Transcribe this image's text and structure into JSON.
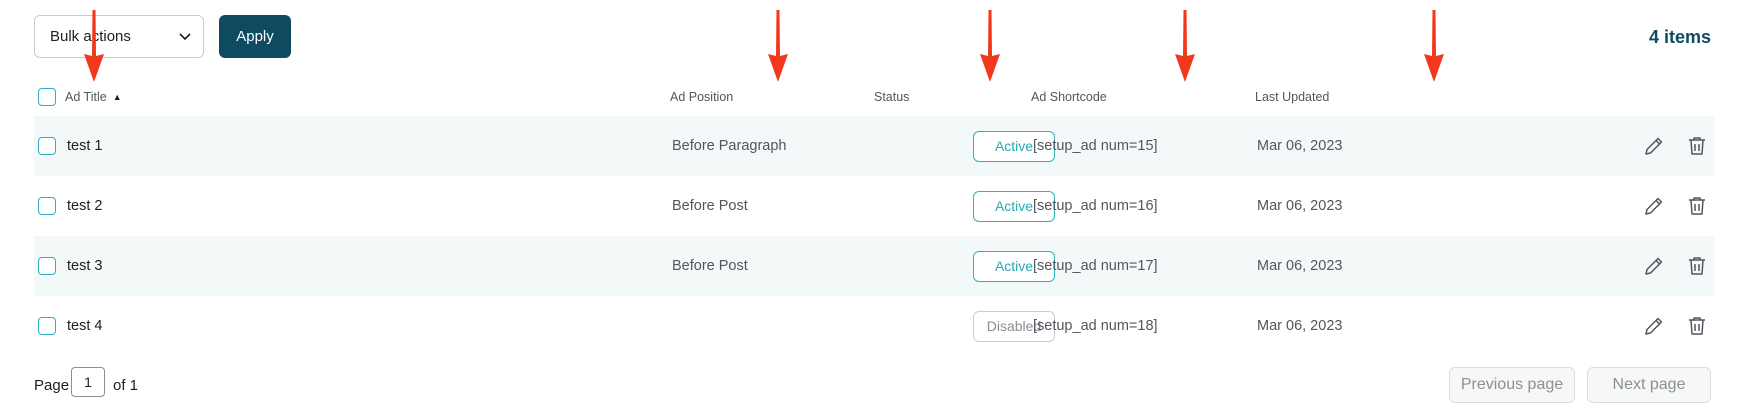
{
  "toolbar": {
    "bulk_label": "Bulk actions",
    "apply_label": "Apply",
    "item_count": "4 items"
  },
  "table": {
    "columns": [
      "Ad Title",
      "Ad Position",
      "Status",
      "Ad Shortcode",
      "Last Updated"
    ],
    "sort_indicator": "▲",
    "rows": [
      {
        "title": "test 1",
        "position": "Before Paragraph",
        "status": "Active",
        "shortcode": "[setup_ad num=15]",
        "updated": "Mar 06, 2023"
      },
      {
        "title": "test 2",
        "position": "Before Post",
        "status": "Active",
        "shortcode": "[setup_ad num=16]",
        "updated": "Mar 06, 2023"
      },
      {
        "title": "test 3",
        "position": "Before Post",
        "status": "Active",
        "shortcode": "[setup_ad num=17]",
        "updated": "Mar 06, 2023"
      },
      {
        "title": "test 4",
        "position": "",
        "status": "Disabled",
        "shortcode": "[setup_ad num=18]",
        "updated": "Mar 06, 2023"
      }
    ]
  },
  "pagination": {
    "page_label": "Page",
    "current_page": "1",
    "of_label": "of 1",
    "prev_label": "Previous page",
    "next_label": "Next page"
  },
  "icons": {
    "edit": "pencil-icon",
    "delete": "trash-icon",
    "annotation": "red-arrow-icon"
  },
  "colors": {
    "primary": "#0e4a60",
    "accent": "#2bb4c0",
    "row_alt": "#f3f8f9",
    "arrow": "#f2381c"
  }
}
